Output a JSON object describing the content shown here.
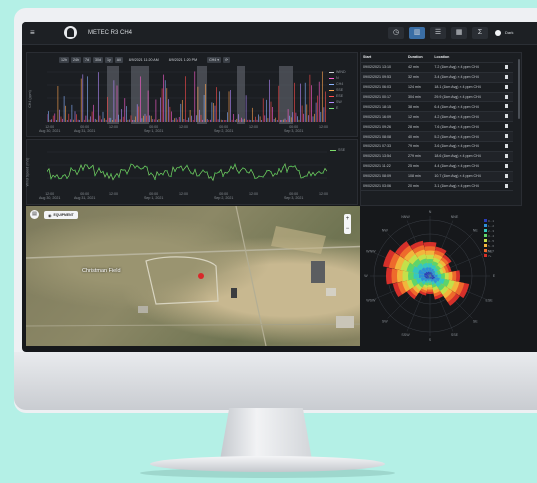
{
  "app": {
    "title": "METEC R3 CH4",
    "menu_icon": "hamburger-icon",
    "logo_icon": "helmet-logo-icon",
    "right_label": "Dark",
    "toolbar_icons": [
      "clock-icon",
      "chart-icon",
      "layers-icon",
      "grid-icon",
      "sigma-icon"
    ]
  },
  "concentration_chart": {
    "controls": [
      "12h",
      "24h",
      "7d",
      "30d",
      "1y",
      "All"
    ],
    "start": "8/9/2021 11:20 AM",
    "end": "8/9/2021 1:20 PM",
    "gas": "CH4",
    "ylabel": "CH4 (ppm)",
    "yticks": [
      "8",
      "6",
      "4",
      "2"
    ],
    "xticks": [
      "12:00\nAug 30, 2021",
      "00:00\nAug 31, 2021",
      "12:00",
      "00:00\nSep 1, 2021",
      "12:00",
      "00:00\nSep 2, 2021",
      "12:00",
      "00:00\nSep 3, 2021",
      "12:00"
    ],
    "legend": [
      "WIND",
      "N",
      "CH4",
      "SSE",
      "ESE",
      "SW",
      "E"
    ]
  },
  "wind_chart": {
    "ylabel": "Wind Speed (m/s)",
    "yticks": [
      "6",
      "4",
      "2"
    ],
    "legend": [
      "SSE"
    ],
    "xticks": [
      "12:00\nAug 30, 2021",
      "00:00\nAug 31, 2021",
      "12:00",
      "00:00\nSep 1, 2021",
      "12:00",
      "00:00\nSep 2, 2021",
      "12:00",
      "00:00\nSep 3, 2021",
      "12:00"
    ]
  },
  "events": {
    "headers": [
      "Start",
      "Duration",
      "Location"
    ],
    "rows": [
      [
        "09/02/2021 13:10",
        "42 min",
        "7.2 (1km Avg) × 4 ppm CH4"
      ],
      [
        "09/02/2021 09:53",
        "32 min",
        "3.4 (1km Avg) × 4 ppm CH4"
      ],
      [
        "09/02/2021 06:03",
        "124 min",
        "18.1 (1km Avg) × 4 ppm CH4"
      ],
      [
        "09/02/2021 00:17",
        "304 min",
        "29.9 (1km Avg) × 4 ppm CH4"
      ],
      [
        "09/02/2021 18:15",
        "38 min",
        "6.4 (1km Avg) × 4 ppm CH4"
      ],
      [
        "09/02/2021 16:09",
        "12 min",
        "4.2 (1km Avg) × 4 ppm CH4"
      ],
      [
        "09/02/2021 09:26",
        "28 min",
        "7.6 (1km Avg) × 4 ppm CH4"
      ],
      [
        "09/02/2021 08:08",
        "40 min",
        "5.2 (1km Avg) × 4 ppm CH4"
      ],
      [
        "09/02/2021 07:33",
        "79 min",
        "3.6 (1km Avg) × 4 ppm CH4"
      ],
      [
        "09/02/2021 13:54",
        "279 min",
        "18.6 (1km Avg) × 4 ppm CH4"
      ],
      [
        "09/02/2021 11:22",
        "25 min",
        "4.4 (1km Avg) × 4 ppm CH4"
      ],
      [
        "09/02/2021 08:09",
        "108 min",
        "10.7 (1km Avg) × 4 ppm CH4"
      ],
      [
        "09/02/2021 03:06",
        "20 min",
        "3.1 (1km Avg) × 4 ppm CH4"
      ]
    ]
  },
  "map": {
    "button_label": "EQUIPMENT",
    "place_label": "Christman Field",
    "zoom_in": "+",
    "zoom_out": "−"
  },
  "wind_rose": {
    "directions": [
      "N",
      "NNE",
      "NE",
      "ENE",
      "E",
      "ESE",
      "SE",
      "SSE",
      "S",
      "SSW",
      "SW",
      "WSW",
      "W",
      "WNW",
      "NW",
      "NNW"
    ],
    "legend": [
      "0 - 1",
      "1 - 2",
      "2 - 3",
      "3 - 4",
      "4 - 5",
      "5 - 6",
      "6 - 7",
      "7+"
    ],
    "colors": [
      "#2a3cb8",
      "#2f8fd8",
      "#35c7c0",
      "#5ed46a",
      "#c4e04a",
      "#f2b53c",
      "#ee6a2c",
      "#d6302a"
    ],
    "rings": [
      "4%",
      "8%",
      "12%"
    ]
  }
}
